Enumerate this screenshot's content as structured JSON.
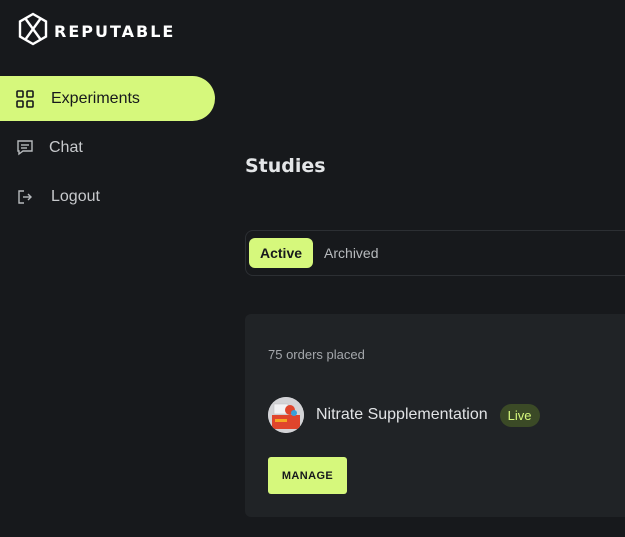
{
  "brand": {
    "name": "REPUTABLE",
    "icon": "reputable-logo-icon"
  },
  "sidebar": {
    "items": [
      {
        "label": "Experiments",
        "icon": "grid-icon",
        "active": true
      },
      {
        "label": "Chat",
        "icon": "chat-icon",
        "active": false
      },
      {
        "label": "Logout",
        "icon": "logout-icon",
        "active": false
      }
    ]
  },
  "main": {
    "title": "Studies",
    "tabs": [
      {
        "label": "Active",
        "active": true
      },
      {
        "label": "Archived",
        "active": false
      }
    ],
    "card": {
      "orders_text": "75 orders placed",
      "study_name": "Nitrate Supplementation",
      "status": "Live",
      "manage_label": "MANAGE"
    }
  },
  "colors": {
    "background": "#17191c",
    "card": "#202326",
    "accent": "#d6f87c",
    "badge_bg": "#3b4a26"
  }
}
